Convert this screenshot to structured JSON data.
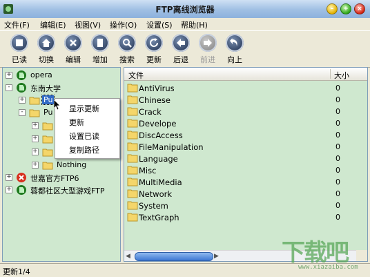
{
  "window": {
    "title": "FTP离线浏览器"
  },
  "menu": [
    "文件(F)",
    "编辑(E)",
    "视图(V)",
    "操作(O)",
    "设置(S)",
    "帮助(H)"
  ],
  "toolbar": [
    {
      "label": "已读",
      "icon": "mark-read-icon",
      "enabled": true
    },
    {
      "label": "切换",
      "icon": "home-icon",
      "enabled": true
    },
    {
      "label": "编辑",
      "icon": "edit-icon",
      "enabled": true
    },
    {
      "label": "增加",
      "icon": "add-icon",
      "enabled": true
    },
    {
      "label": "搜索",
      "icon": "search-icon",
      "enabled": true
    },
    {
      "label": "更新",
      "icon": "refresh-icon",
      "enabled": true
    },
    {
      "label": "后退",
      "icon": "back-icon",
      "enabled": true
    },
    {
      "label": "前进",
      "icon": "forward-icon",
      "enabled": false
    },
    {
      "label": "向上",
      "icon": "up-icon",
      "enabled": true
    }
  ],
  "tree": [
    {
      "label": "opera",
      "expander": "+",
      "icon": "ftp-site-icon"
    },
    {
      "label": "东南大学",
      "expander": "-",
      "icon": "ftp-site-icon"
    },
    {
      "label": "Pu",
      "expander": "+",
      "icon": "folder-icon",
      "selected": true
    },
    {
      "label": "Pu",
      "expander": "-",
      "icon": "folder-open-icon"
    },
    {
      "label": "",
      "expander": "+",
      "icon": "folder-icon"
    },
    {
      "label": "",
      "expander": "+",
      "icon": "folder-icon"
    },
    {
      "label": "",
      "expander": "+",
      "icon": "folder-icon"
    },
    {
      "label": "Nothing",
      "expander": "+",
      "icon": "folder-icon"
    },
    {
      "label": "世嘉官方FTP6",
      "expander": "+",
      "icon": "ftp-site-error-icon"
    },
    {
      "label": "蓉都社区大型游戏FTP",
      "expander": "+",
      "icon": "ftp-site-icon"
    }
  ],
  "list": {
    "columns": {
      "file": "文件",
      "size": "大小"
    },
    "rows": [
      {
        "name": "AntiVirus",
        "size": "0"
      },
      {
        "name": "Chinese",
        "size": "0"
      },
      {
        "name": "Crack",
        "size": "0"
      },
      {
        "name": "Develope",
        "size": "0"
      },
      {
        "name": "DiscAccess",
        "size": "0"
      },
      {
        "name": "FileManipulation",
        "size": "0"
      },
      {
        "name": "Language",
        "size": "0"
      },
      {
        "name": "Misc",
        "size": "0"
      },
      {
        "name": "MultiMedia",
        "size": "0"
      },
      {
        "name": "Network",
        "size": "0"
      },
      {
        "name": "System",
        "size": "0"
      },
      {
        "name": "TextGraph",
        "size": "0"
      }
    ]
  },
  "context_menu": [
    "显示更新",
    "更新",
    "设置已读",
    "复制路径"
  ],
  "status": "更新1/4",
  "watermark": {
    "text": "下载吧",
    "url": "www.xiazaiba.com"
  }
}
